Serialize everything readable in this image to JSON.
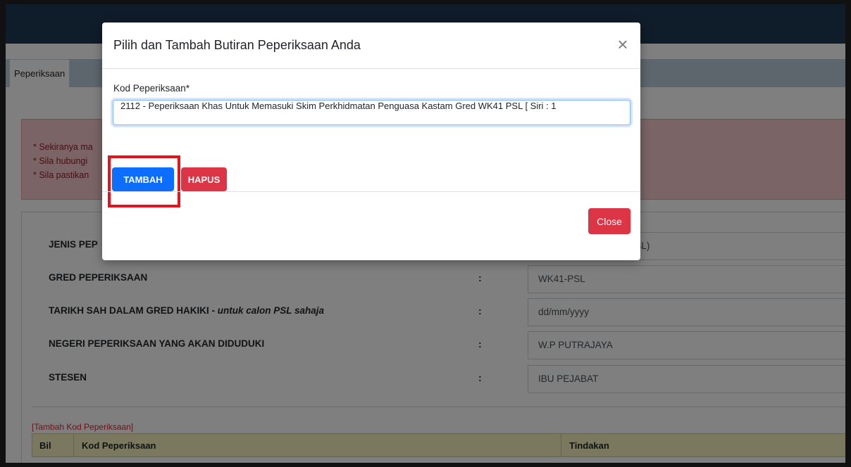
{
  "tabs": {
    "active": "Peperiksaan"
  },
  "alert": {
    "lines": [
      "* Sekiranya ma",
      "* Sila hubungi",
      "* Sila pastikan"
    ]
  },
  "form": {
    "rows": [
      {
        "label": "JENIS PEPERIKSAAN",
        "label_visible": "JENIS PEP",
        "value": "Penguasa Kastam Perkhidmatan Secara Lantikan (PSL)",
        "value_visible": "tan Secara Lantikan (PSL)"
      },
      {
        "label": "GRED PEPERIKSAAN",
        "value": "WK41-PSL"
      },
      {
        "label": "TARIKH SAH DALAM GRED HAKIKI - ",
        "label_em": "untuk calon PSL sahaja",
        "value": "dd/mm/yyyy"
      },
      {
        "label": "NEGERI PEPERIKSAAN YANG AKAN DIDUDUKI",
        "value": "W.P PUTRAJAYA"
      },
      {
        "label": "STESEN",
        "value": "IBU PEJABAT"
      }
    ],
    "colon": ":"
  },
  "exam_table": {
    "add_link": "[Tambah Kod Peperiksaan]",
    "headers": [
      "Bil",
      "Kod Peperiksaan",
      "Tindakan"
    ]
  },
  "modal": {
    "title": "Pilih dan Tambah Butiran Peperiksaan Anda",
    "close_symbol": "×",
    "field_label": "Kod Peperiksaan*",
    "field_value": "2112 - Peperiksaan Khas Untuk Memasuki Skim Perkhidmatan Penguasa Kastam Gred WK41 PSL   [ Siri : 1",
    "tambah_label": "TAMBAH",
    "hapus_label": "HAPUS",
    "close_label": "Close"
  },
  "colors": {
    "primary": "#0d6efd",
    "danger": "#dc3545",
    "highlight": "#e4141c",
    "topbar": "#1e3854"
  }
}
